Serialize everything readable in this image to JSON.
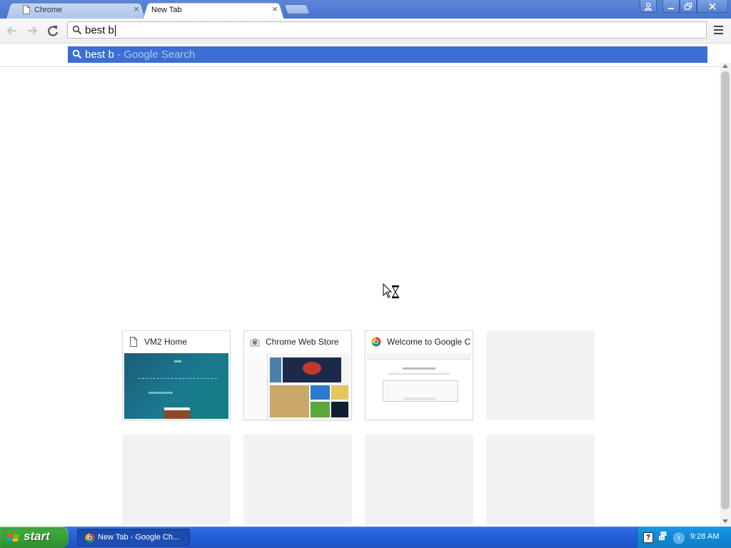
{
  "window": {
    "tabs": [
      {
        "title": "Chrome",
        "active": false
      },
      {
        "title": "New Tab",
        "active": true
      }
    ],
    "close_glyph": "×"
  },
  "toolbar": {
    "omnibox_value": "best b"
  },
  "suggestions": [
    {
      "query": "best b",
      "description": " - Google Search",
      "selected": true
    }
  ],
  "most_visited": [
    {
      "title": "VM2 Home",
      "icon": "page-icon"
    },
    {
      "title": "Chrome Web Store",
      "icon": "chrome-web-store-icon"
    },
    {
      "title": "Welcome to Google Chrome",
      "icon": "chrome-icon"
    }
  ],
  "taskbar": {
    "start_label": "start",
    "task_label": "New Tab - Google Ch...",
    "clock": "9:28 AM",
    "help_glyph": "?"
  },
  "colors": {
    "accent": "#3b6fd1",
    "taskbar": "#245edb",
    "start_green": "#3fa83f"
  }
}
